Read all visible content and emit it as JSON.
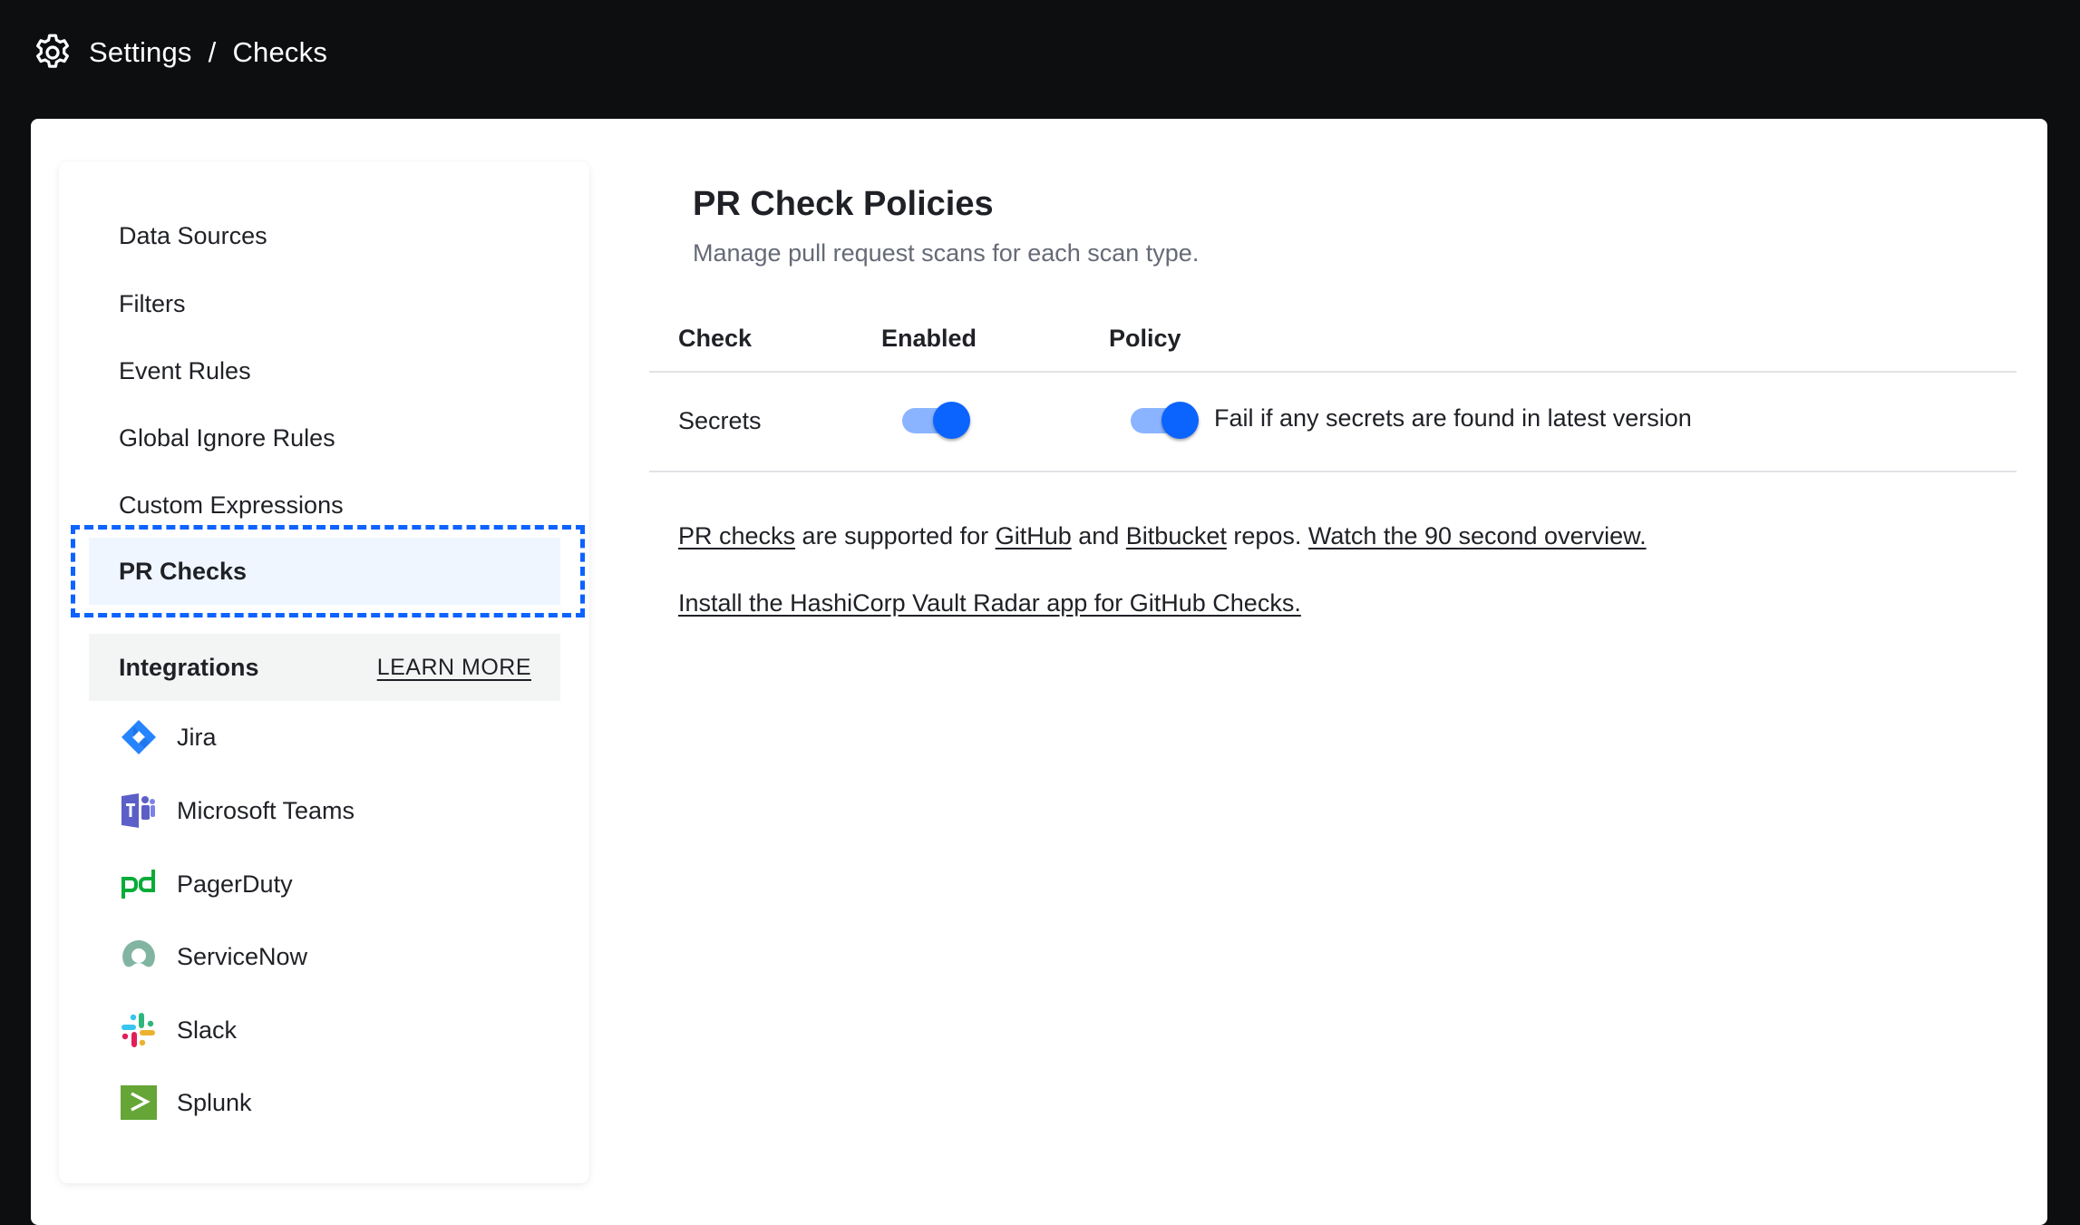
{
  "header": {
    "icon": "gear-icon",
    "breadcrumb": [
      "Settings",
      "Checks"
    ],
    "separator": "/"
  },
  "sidebar": {
    "items": [
      {
        "label": "Data Sources",
        "selected": false
      },
      {
        "label": "Filters",
        "selected": false
      },
      {
        "label": "Event Rules",
        "selected": false
      },
      {
        "label": "Global Ignore Rules",
        "selected": false
      },
      {
        "label": "Custom Expressions",
        "selected": false
      },
      {
        "label": "PR Checks",
        "selected": true
      }
    ],
    "integrations": {
      "title": "Integrations",
      "learn_more": "LEARN MORE",
      "items": [
        {
          "label": "Jira",
          "icon": "jira-icon"
        },
        {
          "label": "Microsoft Teams",
          "icon": "microsoft-teams-icon"
        },
        {
          "label": "PagerDuty",
          "icon": "pagerduty-icon"
        },
        {
          "label": "ServiceNow",
          "icon": "servicenow-icon"
        },
        {
          "label": "Slack",
          "icon": "slack-icon"
        },
        {
          "label": "Splunk",
          "icon": "splunk-icon"
        }
      ]
    }
  },
  "main": {
    "title": "PR Check Policies",
    "subtitle": "Manage pull request scans for each scan type.",
    "table": {
      "columns": [
        "Check",
        "Enabled",
        "Policy"
      ],
      "rows": [
        {
          "check": "Secrets",
          "enabled": true,
          "policy_enabled": true,
          "policy": "Fail if any secrets are found in latest version"
        }
      ]
    },
    "info": {
      "line1": {
        "link_pr_checks": "PR checks",
        "text_1": " are supported for ",
        "link_github": "GitHub",
        "text_2": " and ",
        "link_bitbucket": "Bitbucket",
        "text_3": " repos. ",
        "link_overview": "Watch the 90 second overview."
      },
      "line2": {
        "link_install": "Install the HashiCorp Vault Radar app for GitHub Checks."
      }
    }
  },
  "colors": {
    "accent": "#0c64ff",
    "toggle_track": "#8ab4ff",
    "selected_bg": "#eff6ff",
    "focus_ring": "#0c63ff",
    "topbar_bg": "#0d0e10"
  }
}
